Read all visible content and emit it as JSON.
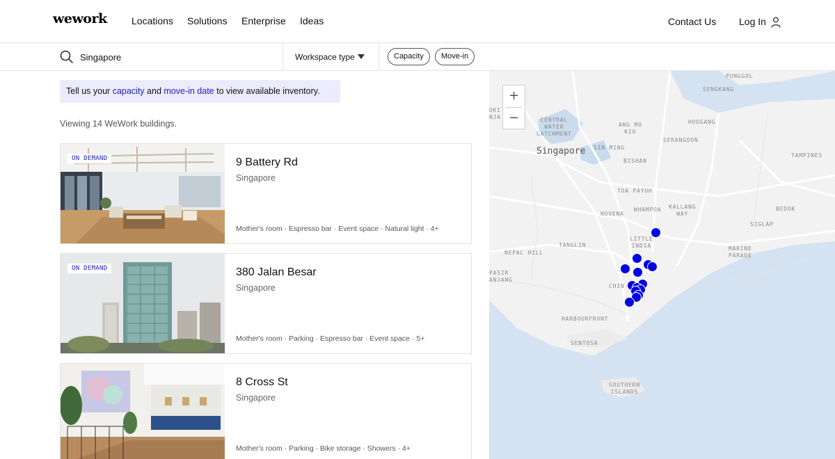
{
  "nav": {
    "logo": "wework",
    "links": [
      "Locations",
      "Solutions",
      "Enterprise",
      "Ideas"
    ],
    "contact": "Contact Us",
    "login": "Log In"
  },
  "filters": {
    "search_value": "Singapore",
    "workspace_type": "Workspace type",
    "chips": [
      "Capacity",
      "Move-in"
    ]
  },
  "banner": {
    "pre": "Tell us your ",
    "capacity_link": "capacity",
    "mid": " and ",
    "movein_link": "move-in date",
    "post": " to view available inventory."
  },
  "viewing_text": "Viewing 14 WeWork buildings.",
  "listings": [
    {
      "badge": "ON DEMAND",
      "title": "9 Battery Rd",
      "city": "Singapore",
      "amenities": "Mother's room · Espresso bar · Event space · Natural light · 4+"
    },
    {
      "badge": "ON DEMAND",
      "title": "380 Jalan Besar",
      "city": "Singapore",
      "amenities": "Mother's room · Parking · Espresso bar · Event space · 5+"
    },
    {
      "badge": "",
      "title": "8 Cross St",
      "city": "Singapore",
      "amenities": "Mother's room · Parking · Bike storage · Showers · 4+"
    }
  ],
  "map": {
    "zoom_in": "+",
    "zoom_out": "−",
    "city_label": "Singapore",
    "labels": [
      "PUNGGOL",
      "SENGKANG",
      "UKI\nNJA",
      "CENTRAL\nWATER\nCATCHMENT",
      "ANG MO\nKIO",
      "HOUGANG",
      "SERANGOON",
      "SIN MING",
      "BISHAN",
      "TAMPINES",
      "TOA PAYOH",
      "KALLANG\nWAY",
      "NOVENA",
      "WHAMPOA",
      "BEDOK",
      "SIGLAP",
      "LITTLE\nINDIA",
      "TANGLIN",
      "NEPAL HILL",
      "MARINE\nPARADE",
      "PASIR\nANJANG",
      "CHIN",
      "HARBOURFRONT",
      "SENTOSA",
      "SOUTHERN\nISLANDS"
    ],
    "pin_color": "#0000e6",
    "pins_count": 14
  }
}
